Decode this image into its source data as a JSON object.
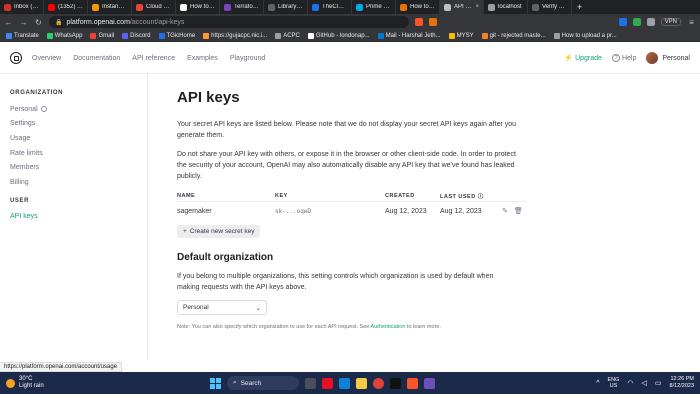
{
  "browser": {
    "tabs": [
      {
        "label": "Inbox (11...",
        "color": "#d93025",
        "active": false
      },
      {
        "label": "(1352) Yo...",
        "color": "#ff0000",
        "active": false
      },
      {
        "label": "Instances",
        "color": "#f29900",
        "active": false
      },
      {
        "label": "Cloud & D...",
        "color": "#ea4335",
        "active": false
      },
      {
        "label": "How to p...",
        "color": "#ffffff",
        "active": false
      },
      {
        "label": "Terraform",
        "color": "#7b42bc",
        "active": false
      },
      {
        "label": "Library Ge...",
        "color": "#5f6368",
        "active": false
      },
      {
        "label": "TheCloudC...",
        "color": "#1a73e8",
        "active": false
      },
      {
        "label": "Prime Vide...",
        "color": "#00a8e1",
        "active": false
      },
      {
        "label": "How to bu...",
        "color": "#e8710a",
        "active": false
      },
      {
        "label": "API key",
        "color": "#bdc1c6",
        "active": true
      },
      {
        "label": "localhost",
        "color": "#9aa0a6",
        "active": false
      },
      {
        "label": "Verify you...",
        "color": "#5f6368",
        "active": false
      }
    ],
    "url_host": "platform.openai.com",
    "url_path": "/account/api-keys",
    "vpn_label": "VPN",
    "bookmarks": [
      {
        "label": "Translate",
        "color": "#4285f4"
      },
      {
        "label": "WhatsApp",
        "color": "#25d366"
      },
      {
        "label": "Gmail",
        "color": "#ea4335"
      },
      {
        "label": "Discord",
        "color": "#5865f2"
      },
      {
        "label": "TGicHome",
        "color": "#1a73e8"
      },
      {
        "label": "https://gujacpc.nic.i...",
        "color": "#ff9933"
      },
      {
        "label": "ACPC",
        "color": "#9aa0a6"
      },
      {
        "label": "GitHub - londonap...",
        "color": "#ffffff"
      },
      {
        "label": "Mail - Harshal Jeth...",
        "color": "#0078d4"
      },
      {
        "label": "MYSY",
        "color": "#fbbc04"
      },
      {
        "label": "git - rejected maste...",
        "color": "#f48024"
      },
      {
        "label": "How to upload a pr...",
        "color": "#9aa0a6"
      }
    ]
  },
  "header": {
    "nav": [
      "Overview",
      "Documentation",
      "API reference",
      "Examples",
      "Playground"
    ],
    "upgrade": "Upgrade",
    "help": "Help",
    "personal": "Personal"
  },
  "sidebar": {
    "org_heading": "ORGANIZATION",
    "org_items": [
      "Personal",
      "Settings",
      "Usage",
      "Rate limits",
      "Members",
      "Billing"
    ],
    "user_heading": "USER",
    "user_items": [
      "API keys"
    ]
  },
  "main": {
    "title": "API keys",
    "para1": "Your secret API keys are listed below. Please note that we do not display your secret API keys again after you generate them.",
    "para2": "Do not share your API key with others, or expose it in the browser or other client-side code. In order to protect the security of your account, OpenAI may also automatically disable any API key that we've found has leaked publicly.",
    "columns": {
      "name": "NAME",
      "key": "KEY",
      "created": "CREATED",
      "last_used": "LAST USED"
    },
    "rows": [
      {
        "name": "sagemaker",
        "key": "sk-...oqwD",
        "created": "Aug 12, 2023",
        "last_used": "Aug 12, 2023"
      }
    ],
    "create_button": "Create new secret key",
    "default_org_title": "Default organization",
    "default_org_desc": "If you belong to multiple organizations, this setting controls which organization is used by default when making requests with the API keys above.",
    "org_select_value": "Personal",
    "note_prefix": "Note: You can also specify which organization to use for each API request. See ",
    "note_link": "Authentication",
    "note_suffix": " to learn more."
  },
  "status_url": "https://platform.openai.com/account/usage",
  "taskbar": {
    "temp": "30°C",
    "weather": "Light rain",
    "search": "Search",
    "lang1": "ENG",
    "lang2": "US",
    "time": "12:26 PM",
    "date": "8/12/2023"
  },
  "colors": {
    "accent": "#10a37f",
    "taskbar": "#1c2a4a"
  }
}
